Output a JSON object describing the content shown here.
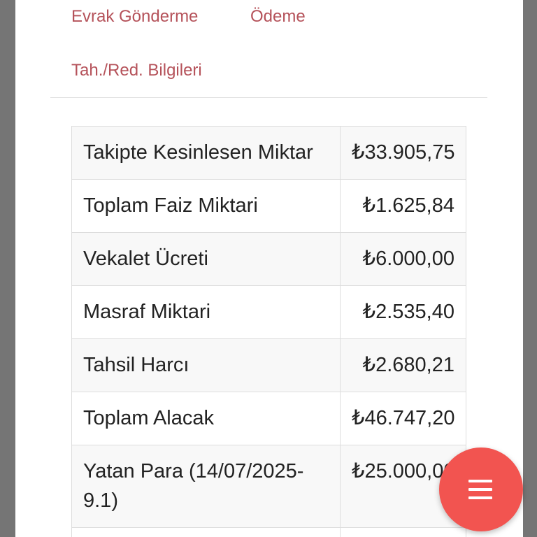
{
  "nav": {
    "tabs": [
      {
        "label": "Evrak Gönderme"
      },
      {
        "label": "Ödeme"
      },
      {
        "label": "Tah./Red. Bilgileri"
      }
    ]
  },
  "summary": {
    "rows": [
      {
        "label": "Takipte Kesinlesen Miktar",
        "value": "₺33.905,75"
      },
      {
        "label": "Toplam Faiz Miktari",
        "value": "₺1.625,84"
      },
      {
        "label": "Vekalet Ücreti",
        "value": "₺6.000,00"
      },
      {
        "label": "Masraf Miktari",
        "value": "₺2.535,40"
      },
      {
        "label": "Tahsil Harcı",
        "value": "₺2.680,21"
      },
      {
        "label": "Toplam Alacak",
        "value": "₺46.747,20"
      },
      {
        "label": "Yatan Para (14/07/2025-9.1)",
        "value": "₺25.000,00"
      }
    ]
  },
  "fab": {
    "icon": "menu-icon",
    "color": "#f25450"
  },
  "colors": {
    "tab_text": "#b5525a",
    "backdrop": "#757575"
  }
}
